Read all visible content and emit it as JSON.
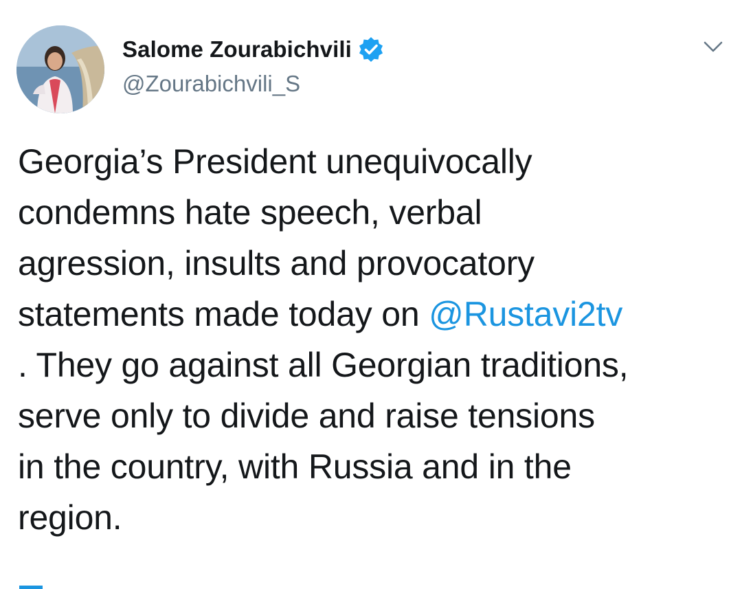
{
  "author": {
    "display_name": "Salome Zourabichvili",
    "handle": "@Zourabichvili_S",
    "verified_icon": "verified-badge-icon",
    "avatar": "profile-photo"
  },
  "menu": {
    "icon": "chevron-down-icon"
  },
  "tweet": {
    "lines": [
      "Georgia’s President unequivocally",
      "condemns hate speech, verbal",
      "agression, insults and provocatory",
      "statements made today on "
    ],
    "mention": "@Rustavi2tv",
    "lines_after": [
      ". They go against all Georgian traditions,",
      "serve only to divide and raise tensions",
      "in the country, with Russia and in the",
      "region."
    ]
  },
  "colors": {
    "link": "#1b95e0",
    "text": "#14171a",
    "secondary": "#657786",
    "verified": "#1da1f2"
  }
}
